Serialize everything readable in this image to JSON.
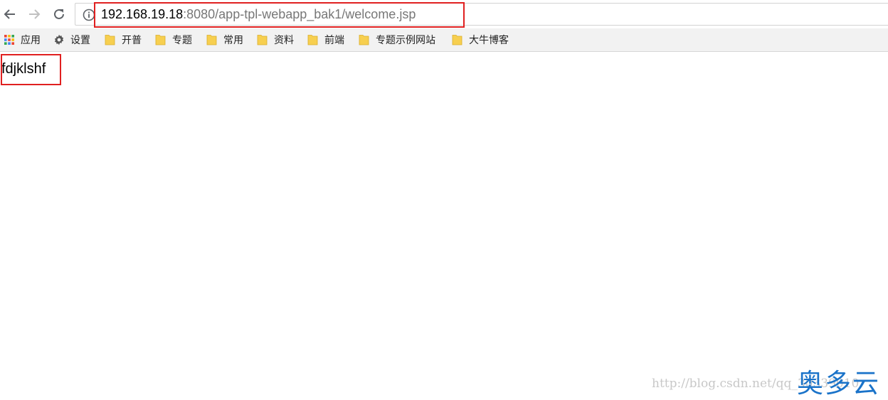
{
  "toolbar": {
    "back_icon": "back-arrow-icon",
    "forward_icon": "forward-arrow-icon",
    "reload_icon": "reload-icon",
    "info_icon": "info-icon"
  },
  "address": {
    "host": "192.168.19.18",
    "rest": ":8080/app-tpl-webapp_bak1/welcome.jsp"
  },
  "bookmarks": {
    "apps": "应用",
    "settings": "设置",
    "items": [
      "开普",
      "专题",
      "常用",
      "资料",
      "前端",
      "专题示例网站",
      "大牛博客"
    ]
  },
  "page": {
    "body_text": "fdjklshf"
  },
  "watermark": {
    "url": "http://blog.csdn.net/qq_30339010",
    "logo": "奥多云"
  },
  "colors": {
    "highlight_box": "#e02020",
    "folder": "#f7cf4f",
    "logo": "#1a73c9"
  }
}
